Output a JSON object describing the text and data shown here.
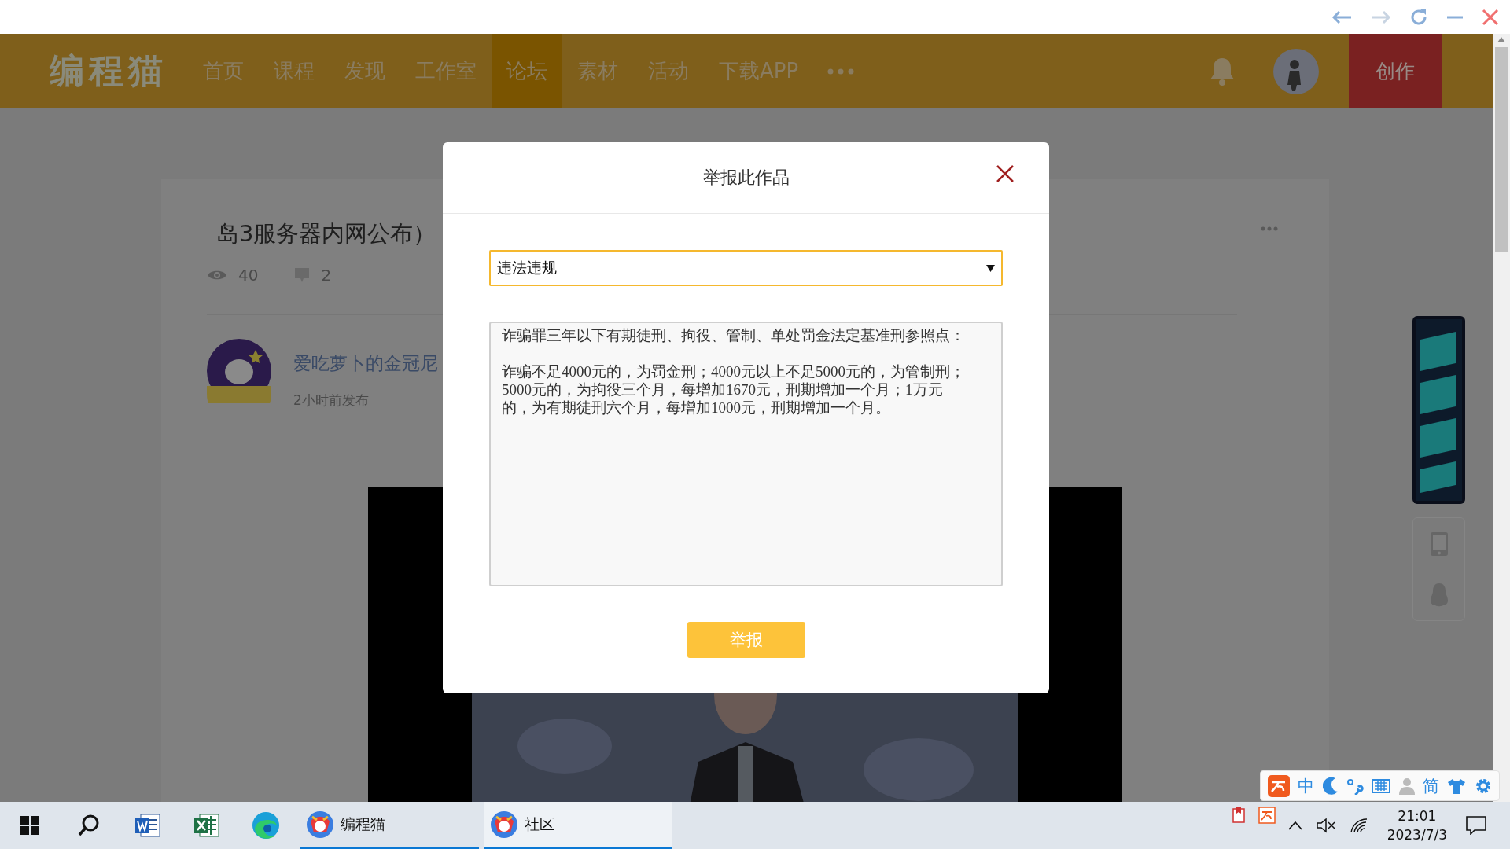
{
  "header": {
    "logo": "编程猫",
    "nav": [
      {
        "label": "首页",
        "selected": false
      },
      {
        "label": "课程",
        "selected": false
      },
      {
        "label": "发现",
        "selected": false
      },
      {
        "label": "工作室",
        "selected": false
      },
      {
        "label": "论坛",
        "selected": true
      },
      {
        "label": "素材",
        "selected": false
      },
      {
        "label": "活动",
        "selected": false
      },
      {
        "label": "下载APP",
        "selected": false
      }
    ],
    "create_button": "创作"
  },
  "post": {
    "title": "岛3服务器内网公布）",
    "views": "40",
    "comments": "2",
    "author": "爱吃萝卜的金冠尼",
    "time": "2小时前发布"
  },
  "modal": {
    "title": "举报此作品",
    "reason": "违法违规",
    "description": [
      "诈骗罪三年以下有期徒刑、拘役、管制、单处罚金法定基准刑参照点：",
      "诈骗不足4000元的，为罚金刑；4000元以上不足5000元的，为管制刑；5000元的，为拘役三个月，每增加1670元，刑期增加一个月；1万元的，为有期徒刑六个月，每增加1000元，刑期增加一个月。"
    ],
    "submit": "举报"
  },
  "ime": {
    "mode": "中",
    "script": "简"
  },
  "taskbar": {
    "apps": [
      {
        "label": "编程猫",
        "selected": false
      },
      {
        "label": "社区",
        "selected": true
      }
    ],
    "time": "21:01",
    "date": "2023/7/3"
  }
}
